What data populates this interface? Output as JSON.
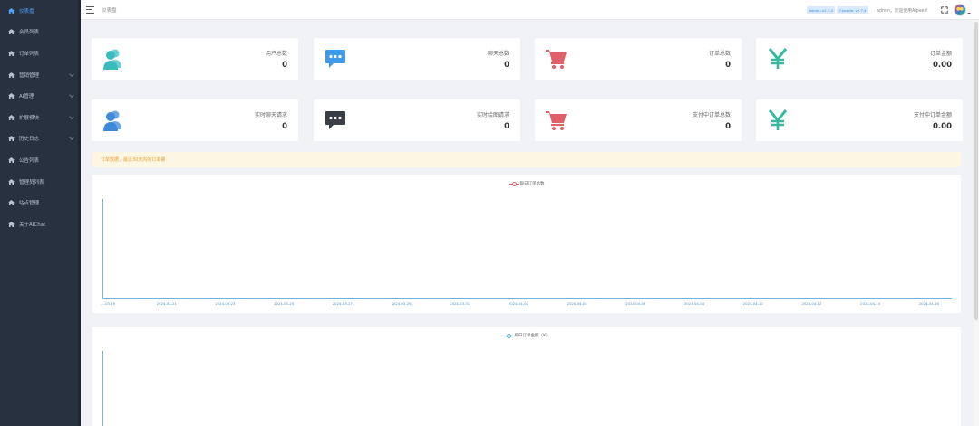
{
  "sidebar": {
    "items": [
      {
        "label": "仪表盘",
        "icon": "home-icon",
        "active": true,
        "has_arrow": false
      },
      {
        "label": "会员列表",
        "icon": "home-icon",
        "active": false,
        "has_arrow": false
      },
      {
        "label": "订单列表",
        "icon": "home-icon",
        "active": false,
        "has_arrow": false
      },
      {
        "label": "营销管理",
        "icon": "home-icon",
        "active": false,
        "has_arrow": true
      },
      {
        "label": "AI管理",
        "icon": "home-icon",
        "active": false,
        "has_arrow": true
      },
      {
        "label": "扩展模块",
        "icon": "home-icon",
        "active": false,
        "has_arrow": true
      },
      {
        "label": "历史日志",
        "icon": "home-icon",
        "active": false,
        "has_arrow": true
      },
      {
        "label": "公告列表",
        "icon": "home-icon",
        "active": false,
        "has_arrow": false
      },
      {
        "label": "管理员列表",
        "icon": "home-icon",
        "active": false,
        "has_arrow": false
      },
      {
        "label": "站点管理",
        "icon": "home-icon",
        "active": false,
        "has_arrow": false
      },
      {
        "label": "关于AIChat",
        "icon": "home-icon",
        "active": false,
        "has_arrow": false
      }
    ]
  },
  "header": {
    "breadcrumb": "仪表盘",
    "badges": [
      "Admin: v2.7.4",
      "Console: v2.7.4"
    ],
    "welcome": "admin，欢迎使用AIpeer!"
  },
  "cards_row1": [
    {
      "label": "用户总数",
      "value": "0",
      "icon": "users-icon",
      "color": "#3cbdbd"
    },
    {
      "label": "聊天总数",
      "value": "0",
      "icon": "chat-bubble-icon",
      "color": "#3d9be9"
    },
    {
      "label": "订单总数",
      "value": "0",
      "icon": "shopping-cart-icon",
      "color": "#e0606a"
    },
    {
      "label": "订单金额",
      "value": "0.00",
      "icon": "yen-icon",
      "color": "#36b9a0"
    }
  ],
  "cards_row2": [
    {
      "label": "实时聊天请求",
      "value": "0",
      "icon": "users-icon",
      "color": "#3d8bd8"
    },
    {
      "label": "实时绘图请求",
      "value": "0",
      "icon": "chat-bubble-icon",
      "color": "#3a3f47"
    },
    {
      "label": "支付中订单总数",
      "value": "0",
      "icon": "shopping-cart-icon",
      "color": "#e0606a"
    },
    {
      "label": "支付中订单金额",
      "value": "0.00",
      "icon": "yen-icon",
      "color": "#36b9a0"
    }
  ],
  "notice": "订单数据，最近30天内的订单量",
  "chart_data": [
    {
      "type": "line",
      "series": [
        {
          "name": "每日订单总数",
          "values": []
        }
      ],
      "x": [
        "2024-03-19",
        "2024-03-21",
        "2024-03-23",
        "2024-03-25",
        "2024-03-27",
        "2024-03-29",
        "2024-03-31",
        "2024-04-02",
        "2024-04-04",
        "2024-04-06",
        "2024-04-08",
        "2024-04-10",
        "2024-04-12",
        "2024-04-14",
        "2024-04-16"
      ],
      "x_tick_labels": [
        "…-03-19",
        "2024-03-21",
        "2024-03-23",
        "2024-03-25",
        "2024-03-27",
        "2024-03-29",
        "2024-03-31",
        "2024-04-02",
        "2024-04-04",
        "2024-04-06",
        "2024-04-08",
        "2024-04-10",
        "2024-04-12",
        "2024-04-14",
        "2024-04-16"
      ],
      "grid": false,
      "legend": "top-center"
    },
    {
      "type": "line",
      "series": [
        {
          "name": "每日订单金额（¥）",
          "values": []
        }
      ],
      "grid": false,
      "legend": "top-center"
    }
  ]
}
